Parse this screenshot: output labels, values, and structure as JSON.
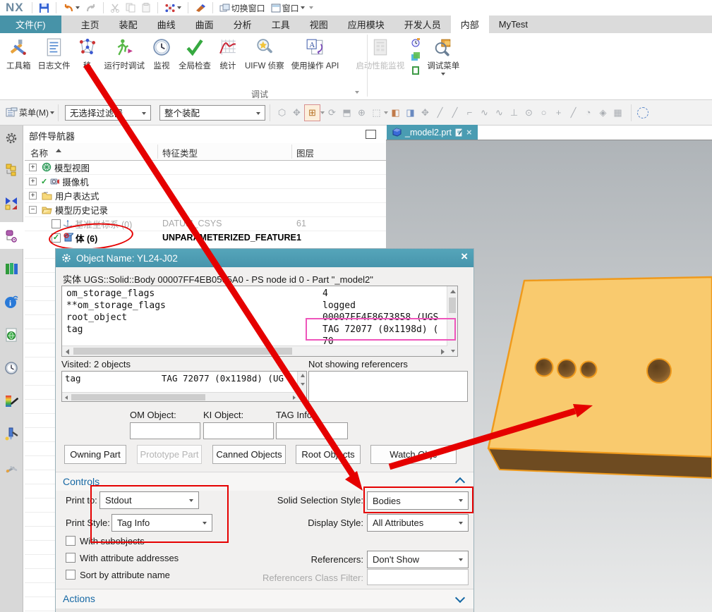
{
  "app": {
    "logo": "NX"
  },
  "titlebar": {
    "switch_window": "切换窗口",
    "window": "窗口"
  },
  "tabs": {
    "items": [
      "文件(F)",
      "主页",
      "装配",
      "曲线",
      "曲面",
      "分析",
      "工具",
      "视图",
      "应用模块",
      "开发人员",
      "内部",
      "MyTest"
    ],
    "active": "内部"
  },
  "ribbon": {
    "group_label": "调试",
    "tools": [
      {
        "label": "工具箱"
      },
      {
        "label": "日志文件"
      },
      {
        "label": "移"
      },
      {
        "label": "运行时调试"
      },
      {
        "label": "监视"
      },
      {
        "label": "全局检查"
      },
      {
        "label": "统计"
      },
      {
        "label": "UIFW 侦察"
      },
      {
        "label": "使用操作 API"
      },
      {
        "label": "启动性能监视"
      },
      {
        "label": "调试菜单"
      }
    ]
  },
  "toolbar": {
    "menu": "菜单(M)",
    "selection_filter": "无选择过滤器",
    "scope": "整个装配"
  },
  "part_navigator": {
    "title": "部件导航器",
    "columns": [
      "名称",
      "特征类型",
      "图层"
    ],
    "rows": [
      {
        "name": "模型视图",
        "type": "",
        "layer": ""
      },
      {
        "name": "摄像机",
        "type": "",
        "layer": ""
      },
      {
        "name": "用户表达式",
        "type": "",
        "layer": ""
      },
      {
        "name": "模型历史记录",
        "type": "",
        "layer": ""
      },
      {
        "name": "基准坐标系 (0)",
        "type": "DATUM_CSYS",
        "layer": "61"
      },
      {
        "name": "体 (6)",
        "type": "UNPARAMETERIZED_FEATURE",
        "layer": "1"
      }
    ]
  },
  "viewport": {
    "tab": "_model2.prt"
  },
  "dialog": {
    "title": "Object Name: YL24-J02",
    "subtitle": "实体 UGS::Solid::Body 00007FF4EB0565A0 - PS node id 0 - Part \"_model2\"",
    "listing": [
      {
        "name": "om_storage_flags",
        "value": "4"
      },
      {
        "name": "**om_storage_flags",
        "value": "logged"
      },
      {
        "name": "root_object",
        "value": "00007FF4F8673858 (UGS"
      },
      {
        "name": "tag",
        "value": "TAG 72077 (0x1198d) ("
      },
      {
        "name": "",
        "value": "70"
      }
    ],
    "visited_label": "Visited: 2 objects",
    "not_showing_label": "Not showing referencers",
    "visited_row": {
      "name": "tag",
      "value": "TAG 72077 (0x1198d) (UG"
    },
    "field_labels": {
      "om": "OM Object:",
      "ki": "KI Object:",
      "tag": "TAG Info:"
    },
    "buttons": [
      "Owning Part",
      "Prototype Part",
      "Canned Objects",
      "Root Objects",
      "Watch Obje"
    ],
    "controls": {
      "header": "Controls",
      "print_to_label": "Print to:",
      "print_to_value": "Stdout",
      "print_style_label": "Print Style:",
      "print_style_value": "Tag Info",
      "solid_selection_label": "Solid Selection Style:",
      "solid_selection_value": "Bodies",
      "display_style_label": "Display Style:",
      "display_style_value": "All Attributes",
      "with_subobjects": "With subobjects",
      "with_attribute_addresses": "With attribute addresses",
      "sort_by_attribute_name": "Sort by attribute name",
      "referencers_label": "Referencers:",
      "referencers_value": "Don't Show",
      "referencers_class_filter_label": "Referencers Class Filter:"
    },
    "actions_header": "Actions"
  },
  "colors": {
    "accent_teal": "#4a9cb2",
    "annotation_red": "#e50000",
    "annotation_magenta": "#ee55bb",
    "section_blue": "#1668a4",
    "model_fill": "#f9ca6e",
    "model_edge": "#ef9a1c"
  }
}
